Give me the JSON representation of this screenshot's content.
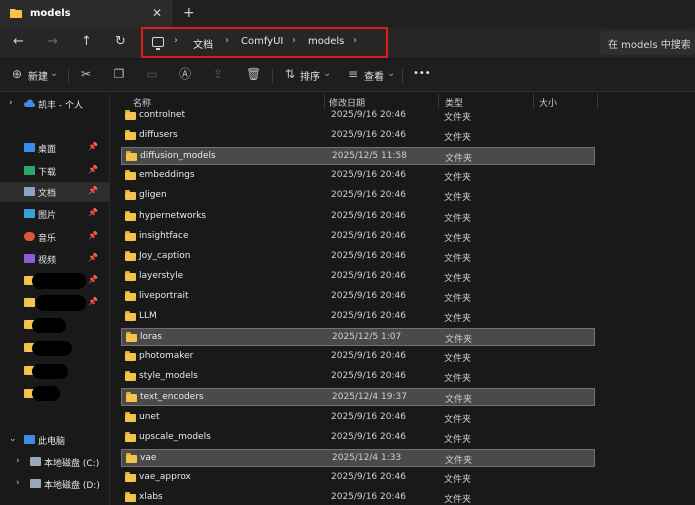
{
  "tab": {
    "title": "models",
    "close": "✕",
    "new": "+"
  },
  "nav": {
    "back": "←",
    "forward": "→",
    "up": "↑",
    "refresh": "↻"
  },
  "breadcrumb": {
    "items": [
      "文档",
      "ComfyUI",
      "models"
    ],
    "sep": "›"
  },
  "search": {
    "placeholder": "在 models 中搜索"
  },
  "toolbar": {
    "new_label": "新建",
    "sort_label": "排序",
    "view_label": "查看",
    "more": "•••"
  },
  "sidebar": {
    "onedrive": "凯丰 - 个人",
    "quick": [
      {
        "label": "桌面",
        "color": "#3a8ee6"
      },
      {
        "label": "下载",
        "color": "#2ea56a"
      },
      {
        "label": "文档",
        "color": "#8aa4c8"
      },
      {
        "label": "图片",
        "color": "#3aa0d8"
      },
      {
        "label": "音乐",
        "color": "#e0533d"
      },
      {
        "label": "视频",
        "color": "#8c5bd6"
      }
    ],
    "this_pc": "此电脑",
    "drives": [
      "本地磁盘 (C:)",
      "本地磁盘 (D:)"
    ]
  },
  "columns": {
    "name": "名称",
    "date": "修改日期",
    "type": "类型",
    "size": "大小"
  },
  "files": [
    {
      "name": "controlnet",
      "date": "2025/9/16 20:46",
      "type": "文件夹",
      "selected": false
    },
    {
      "name": "diffusers",
      "date": "2025/9/16 20:46",
      "type": "文件夹",
      "selected": false
    },
    {
      "name": "diffusion_models",
      "date": "2025/12/5 11:58",
      "type": "文件夹",
      "selected": true
    },
    {
      "name": "embeddings",
      "date": "2025/9/16 20:46",
      "type": "文件夹",
      "selected": false
    },
    {
      "name": "gligen",
      "date": "2025/9/16 20:46",
      "type": "文件夹",
      "selected": false
    },
    {
      "name": "hypernetworks",
      "date": "2025/9/16 20:46",
      "type": "文件夹",
      "selected": false
    },
    {
      "name": "insightface",
      "date": "2025/9/16 20:46",
      "type": "文件夹",
      "selected": false
    },
    {
      "name": "Joy_caption",
      "date": "2025/9/16 20:46",
      "type": "文件夹",
      "selected": false
    },
    {
      "name": "layerstyle",
      "date": "2025/9/16 20:46",
      "type": "文件夹",
      "selected": false
    },
    {
      "name": "liveportrait",
      "date": "2025/9/16 20:46",
      "type": "文件夹",
      "selected": false
    },
    {
      "name": "LLM",
      "date": "2025/9/16 20:46",
      "type": "文件夹",
      "selected": false
    },
    {
      "name": "loras",
      "date": "2025/12/5 1:07",
      "type": "文件夹",
      "selected": true
    },
    {
      "name": "photomaker",
      "date": "2025/9/16 20:46",
      "type": "文件夹",
      "selected": false
    },
    {
      "name": "style_models",
      "date": "2025/9/16 20:46",
      "type": "文件夹",
      "selected": false
    },
    {
      "name": "text_encoders",
      "date": "2025/12/4 19:37",
      "type": "文件夹",
      "selected": true
    },
    {
      "name": "unet",
      "date": "2025/9/16 20:46",
      "type": "文件夹",
      "selected": false
    },
    {
      "name": "upscale_models",
      "date": "2025/9/16 20:46",
      "type": "文件夹",
      "selected": false
    },
    {
      "name": "vae",
      "date": "2025/12/4 1:33",
      "type": "文件夹",
      "selected": true
    },
    {
      "name": "vae_approx",
      "date": "2025/9/16 20:46",
      "type": "文件夹",
      "selected": false
    },
    {
      "name": "xlabs",
      "date": "2025/9/16 20:46",
      "type": "文件夹",
      "selected": false
    }
  ]
}
